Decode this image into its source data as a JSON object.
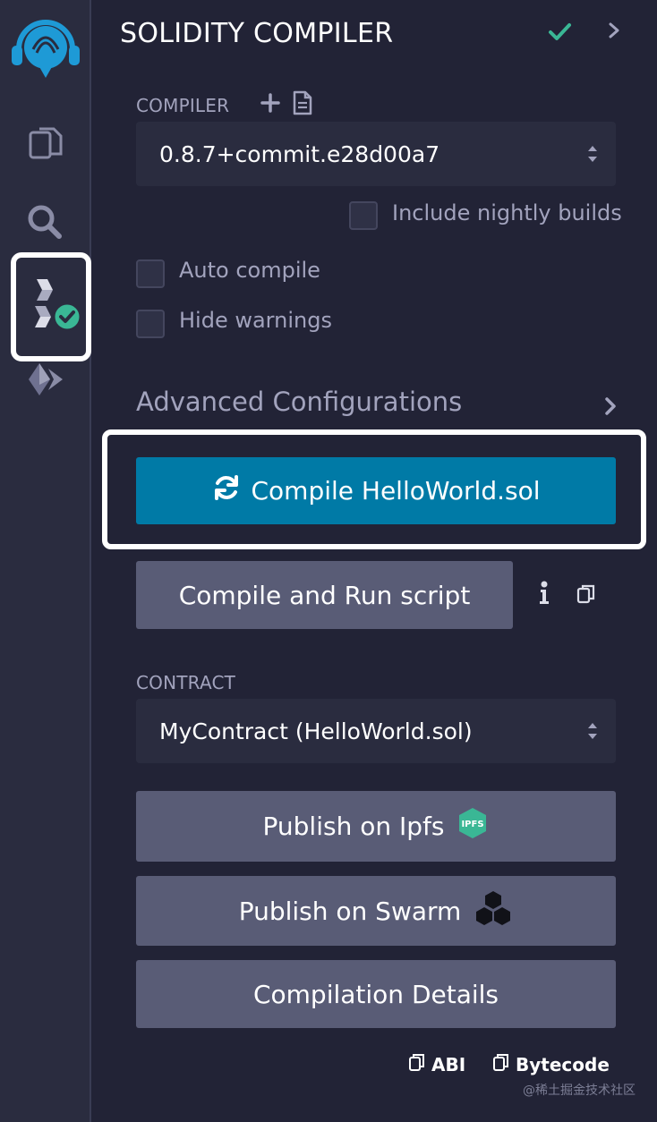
{
  "iconbar": {
    "items": [
      {
        "name": "remix-logo-icon"
      },
      {
        "name": "file-explorer-icon"
      },
      {
        "name": "search-icon"
      },
      {
        "name": "solidity-compiler-icon"
      },
      {
        "name": "deploy-run-icon"
      }
    ]
  },
  "header": {
    "title": "SOLIDITY COMPILER",
    "status_icon": "check-icon",
    "chevron_icon": "chevron-right-icon"
  },
  "compiler": {
    "label": "COMPILER",
    "selected_version": "0.8.7+commit.e28d00a7",
    "nightly_label": "Include nightly builds",
    "nightly_checked": false
  },
  "options": {
    "auto_compile_label": "Auto compile",
    "auto_compile_checked": false,
    "hide_warnings_label": "Hide warnings",
    "hide_warnings_checked": false
  },
  "advanced": {
    "label": "Advanced Configurations"
  },
  "actions": {
    "compile_label": "Compile HelloWorld.sol",
    "compile_run_label": "Compile and Run script"
  },
  "contract": {
    "label": "CONTRACT",
    "selected": "MyContract (HelloWorld.sol)"
  },
  "publish": {
    "ipfs_label": "Publish on Ipfs",
    "ipfs_badge": "IPFS",
    "swarm_label": "Publish on Swarm",
    "details_label": "Compilation Details"
  },
  "copy": {
    "abi_label": "ABI",
    "bytecode_label": "Bytecode"
  },
  "watermark": "@稀土掘金技术社区",
  "colors": {
    "background": "#222336",
    "iconbar": "#2a2c3f",
    "primary": "#007aa6",
    "secondary": "#595c76",
    "success": "#3ab795"
  }
}
